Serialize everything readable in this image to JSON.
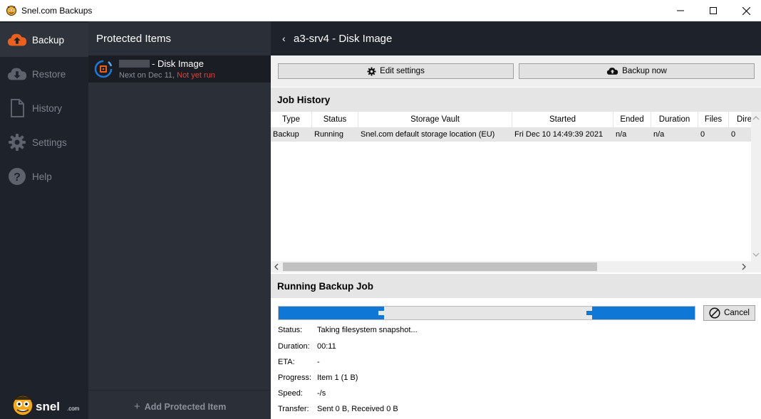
{
  "window": {
    "title": "Snel.com Backups",
    "app_icon": "snel-logo-icon"
  },
  "nav": {
    "items": [
      {
        "label": "Backup",
        "icon": "cloud-upload-icon",
        "active": true
      },
      {
        "label": "Restore",
        "icon": "cloud-download-icon",
        "active": false
      },
      {
        "label": "History",
        "icon": "document-icon",
        "active": false
      },
      {
        "label": "Settings",
        "icon": "gear-icon",
        "active": false
      },
      {
        "label": "Help",
        "icon": "help-icon",
        "active": false
      }
    ],
    "logo_text": "snel",
    "logo_suffix": ".com"
  },
  "protected_items": {
    "title": "Protected Items",
    "items": [
      {
        "name": "- Disk Image",
        "schedule": "Next on Dec 11,",
        "status": "Not yet run",
        "icon": "disk-image-icon"
      }
    ],
    "add_label": "Add Protected Item"
  },
  "main": {
    "title": "a3-srv4 - Disk Image",
    "edit_label": "Edit settings",
    "backup_label": "Backup now",
    "job_history": {
      "title": "Job History",
      "columns": [
        "Type",
        "Status",
        "Storage Vault",
        "Started",
        "Ended",
        "Duration",
        "Files",
        "Dire"
      ],
      "rows": [
        {
          "type": "Backup",
          "status": "Running",
          "vault": "Snel.com default storage location (EU)",
          "started": "Fri Dec 10 14:49:39 2021",
          "ended": "n/a",
          "duration": "n/a",
          "files": "0",
          "dirs": "0"
        }
      ]
    },
    "running": {
      "title": "Running Backup Job",
      "cancel_label": "Cancel",
      "fields": [
        {
          "key": "Status:",
          "value": "Taking filesystem snapshot..."
        },
        {
          "key": "Duration:",
          "value": "00:11"
        },
        {
          "key": "ETA:",
          "value": "-"
        },
        {
          "key": "Progress:",
          "value": "Item 1 (1 B)"
        },
        {
          "key": "Speed:",
          "value": "-/s"
        },
        {
          "key": "Transfer:",
          "value": "Sent 0 B, Received 0 B"
        }
      ]
    }
  },
  "colors": {
    "nav_bg": "#1e222b",
    "items_bg": "#2b2f38",
    "accent_blue": "#0f78d7",
    "warning_red": "#e3413c",
    "backup_orange": "#e9601f"
  }
}
